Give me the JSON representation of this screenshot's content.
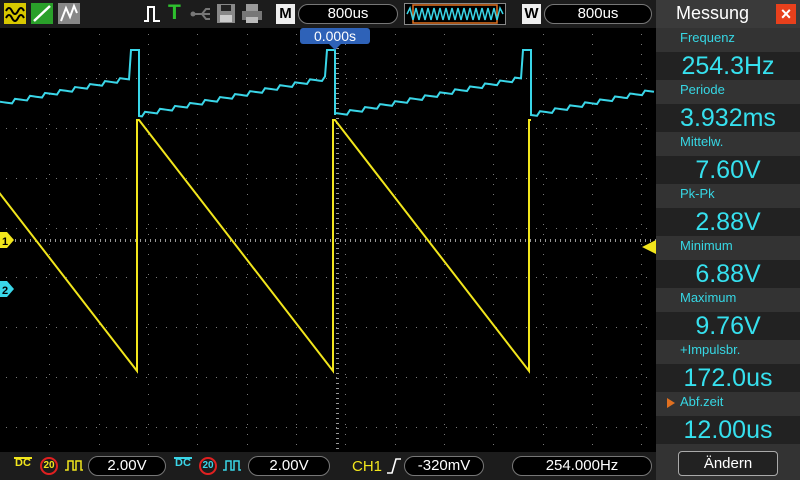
{
  "topbar": {
    "mode_label": "M",
    "timebase": "800us",
    "window_label": "W",
    "window_timebase": "800us",
    "trigger_status": "T"
  },
  "screen": {
    "trigger_position": "0.000s",
    "ch1_marker": "1",
    "ch2_marker": "2"
  },
  "panel": {
    "title": "Messung",
    "measurements": [
      {
        "label": "Frequenz",
        "value": "254.3Hz"
      },
      {
        "label": "Periode",
        "value": "3.932ms"
      },
      {
        "label": "Mittelw.",
        "value": "7.60V"
      },
      {
        "label": "Pk-Pk",
        "value": "2.88V"
      },
      {
        "label": "Minimum",
        "value": "6.88V"
      },
      {
        "label": "Maximum",
        "value": "9.76V"
      },
      {
        "label": "+Impulsbr.",
        "value": "172.0us"
      },
      {
        "label": "Abf.zeit",
        "value": "12.00us"
      }
    ],
    "change_button": "Ändern"
  },
  "bottombar": {
    "ch1_coupling": "DC",
    "ch1_bw_limit": "20",
    "ch1_scale": "2.00V",
    "ch2_coupling": "DC",
    "ch2_bw_limit": "20",
    "ch2_scale": "2.00V",
    "trigger_source": "CH1",
    "trigger_level": "-320mV",
    "trigger_frequency": "254.000Hz"
  },
  "colors": {
    "ch1": "#f2e61c",
    "ch2": "#3ad6e8",
    "accent": "#e8401c",
    "measure_text": "#36e0ee"
  }
}
